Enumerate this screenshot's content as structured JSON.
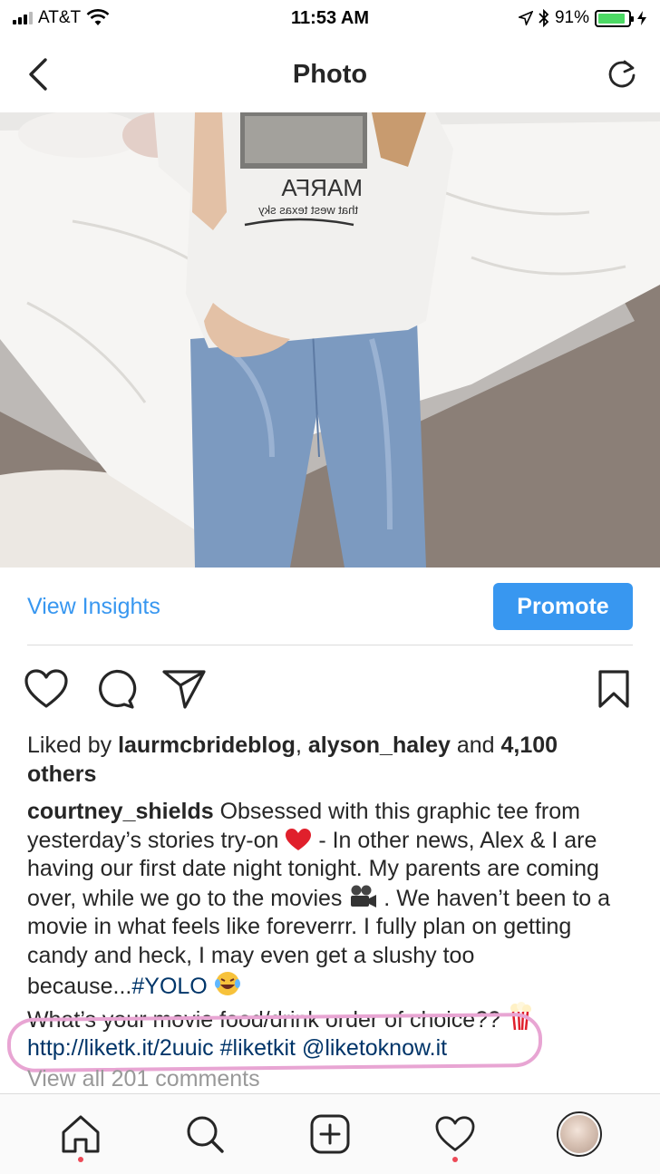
{
  "status_bar": {
    "carrier": "AT&T",
    "time": "11:53 AM",
    "battery": "91%",
    "battery_level": 0.91
  },
  "nav": {
    "title": "Photo",
    "back_icon": "chevron-left-icon",
    "refresh_icon": "refresh-icon"
  },
  "insights": {
    "view_insights": "View Insights",
    "promote": "Promote"
  },
  "actions": {
    "like_icon": "heart-icon",
    "comment_icon": "comment-icon",
    "share_icon": "send-icon",
    "save_icon": "bookmark-icon"
  },
  "likes": {
    "prefix": "Liked by ",
    "user1": "laurmcbrideblog",
    "sep": ", ",
    "user2": "alyson_haley",
    "and": " and ",
    "others": "4,100 others"
  },
  "caption": {
    "username": "courtney_shields",
    "text1": " Obsessed with this graphic tee from yesterday’s stories try-on ",
    "text2": " - In other news, Alex & I are having our first date night tonight. My parents are coming over, while we go to the movies ",
    "text3": " . We haven’t been to a movie in what feels like foreverrr. I fully plan on getting candy and heck, I may even get a slushy too because...",
    "hashtag_yolo": "#YOLO",
    "text4": "What’s your movie food/drink order of choice?? ",
    "url": "http://liketk.it/2uuic",
    "hashtag_liketkit": "#liketkit",
    "mention": "@liketoknow.it"
  },
  "comments": {
    "view_all": "View all 201 comments"
  },
  "tab_bar": {
    "items": [
      "home-icon",
      "search-icon",
      "add-post-icon",
      "activity-heart-icon",
      "profile-avatar"
    ]
  },
  "colors": {
    "accent": "#3897f0",
    "link": "#003569",
    "highlight": "#e8a5d3",
    "notification_dot": "#ed4956"
  }
}
